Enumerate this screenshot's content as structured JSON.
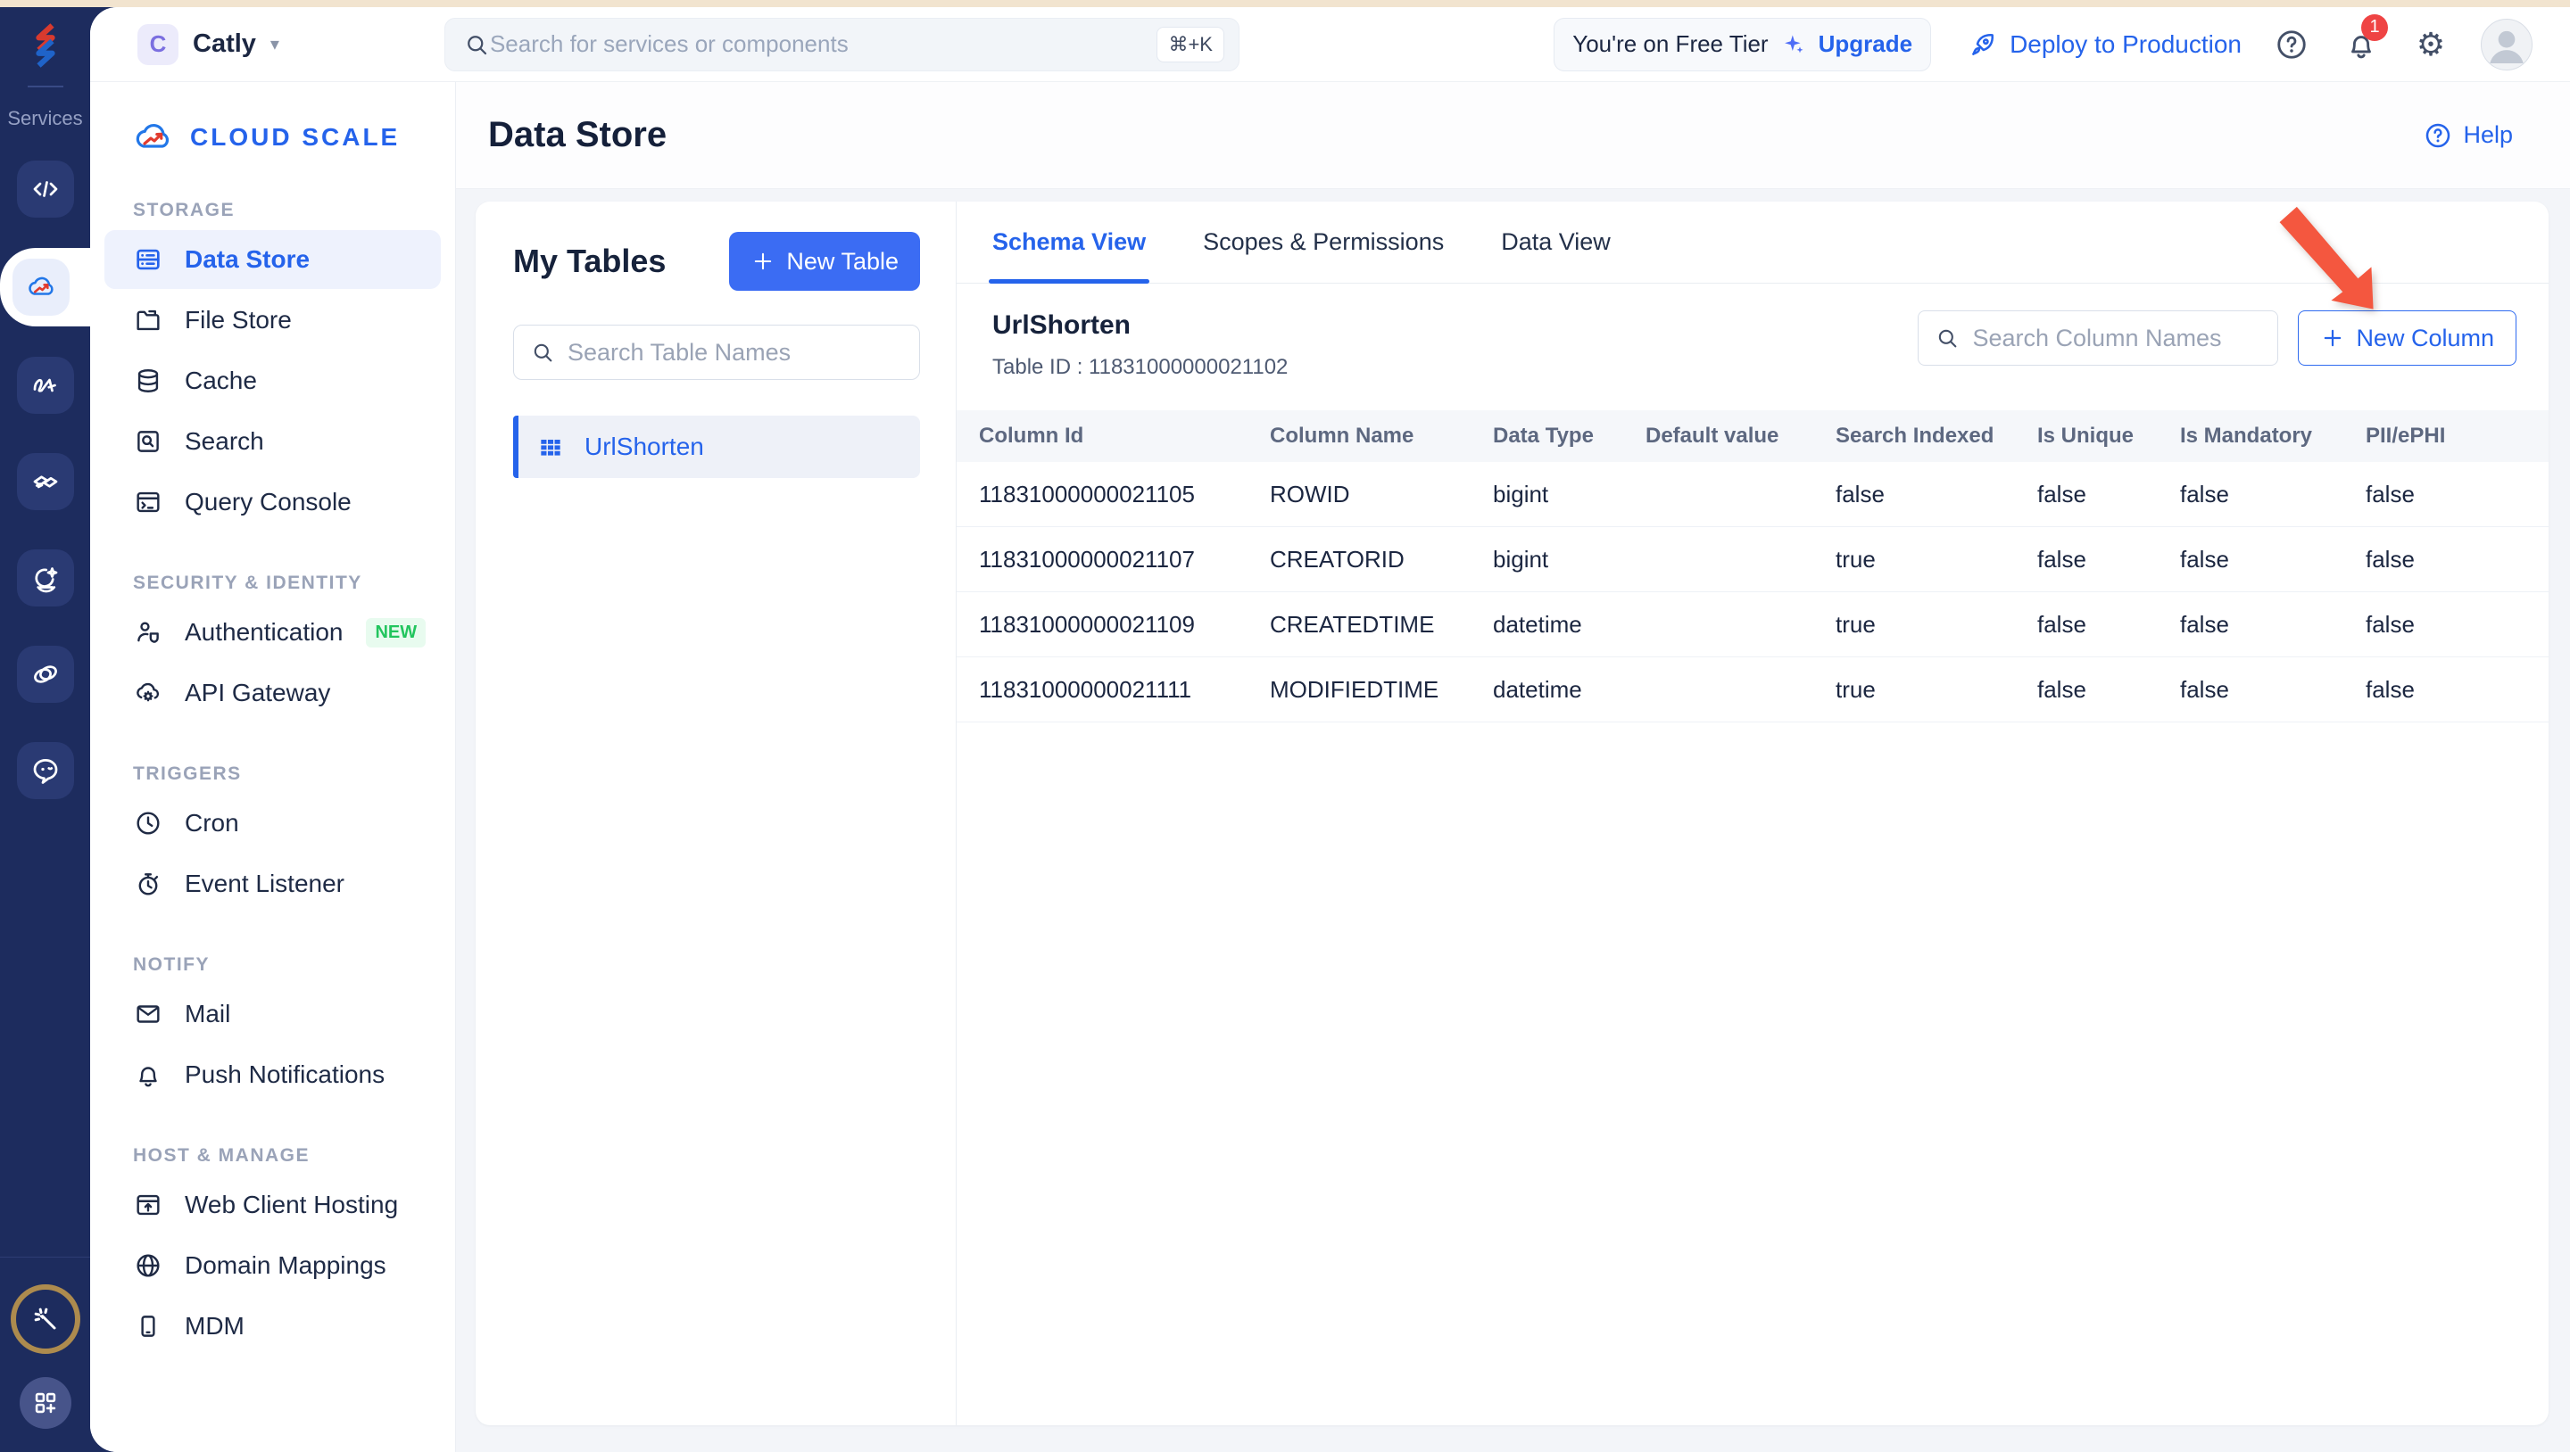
{
  "topbar": {
    "project": {
      "initial": "C",
      "name": "Catly"
    },
    "search_placeholder": "Search for services or components",
    "shortcut": "⌘+K",
    "free_tier": "You're on Free Tier",
    "upgrade": "Upgrade",
    "deploy": "Deploy to Production",
    "notification_count": "1"
  },
  "rail": {
    "services_label": "Services"
  },
  "sidebar": {
    "brand": "CLOUD SCALE",
    "sections": [
      {
        "label": "STORAGE",
        "items": [
          {
            "label": "Data Store"
          },
          {
            "label": "File Store"
          },
          {
            "label": "Cache"
          },
          {
            "label": "Search"
          },
          {
            "label": "Query Console"
          }
        ]
      },
      {
        "label": "SECURITY & IDENTITY",
        "items": [
          {
            "label": "Authentication",
            "badge": "NEW"
          },
          {
            "label": "API Gateway"
          }
        ]
      },
      {
        "label": "TRIGGERS",
        "items": [
          {
            "label": "Cron"
          },
          {
            "label": "Event Listener"
          }
        ]
      },
      {
        "label": "NOTIFY",
        "items": [
          {
            "label": "Mail"
          },
          {
            "label": "Push Notifications"
          }
        ]
      },
      {
        "label": "HOST & MANAGE",
        "items": [
          {
            "label": "Web Client Hosting"
          },
          {
            "label": "Domain Mappings"
          },
          {
            "label": "MDM"
          }
        ]
      }
    ]
  },
  "page": {
    "title": "Data Store",
    "help": "Help"
  },
  "tables_panel": {
    "title": "My Tables",
    "new_table": "New Table",
    "search_placeholder": "Search Table Names",
    "items": [
      {
        "name": "UrlShorten"
      }
    ]
  },
  "tabs": [
    {
      "label": "Schema View"
    },
    {
      "label": "Scopes & Permissions"
    },
    {
      "label": "Data View"
    }
  ],
  "schema": {
    "table_name": "UrlShorten",
    "table_id_label": "Table ID : 11831000000021102",
    "search_placeholder": "Search Column Names",
    "new_column": "New Column",
    "columns": [
      "Column Id",
      "Column Name",
      "Data Type",
      "Default value",
      "Search Indexed",
      "Is Unique",
      "Is Mandatory",
      "PII/ePHI"
    ],
    "rows": [
      [
        "11831000000021105",
        "ROWID",
        "bigint",
        "",
        "false",
        "false",
        "false",
        "false"
      ],
      [
        "11831000000021107",
        "CREATORID",
        "bigint",
        "",
        "true",
        "false",
        "false",
        "false"
      ],
      [
        "11831000000021109",
        "CREATEDTIME",
        "datetime",
        "",
        "true",
        "false",
        "false",
        "false"
      ],
      [
        "11831000000021111",
        "MODIFIEDTIME",
        "datetime",
        "",
        "true",
        "false",
        "false",
        "false"
      ]
    ]
  },
  "colors": {
    "accent": "#2563eb",
    "rail_bg": "#1d2c5e",
    "annotation": "#f4573f",
    "badge_green": "#22c55e",
    "alert_red": "#ef4444"
  }
}
